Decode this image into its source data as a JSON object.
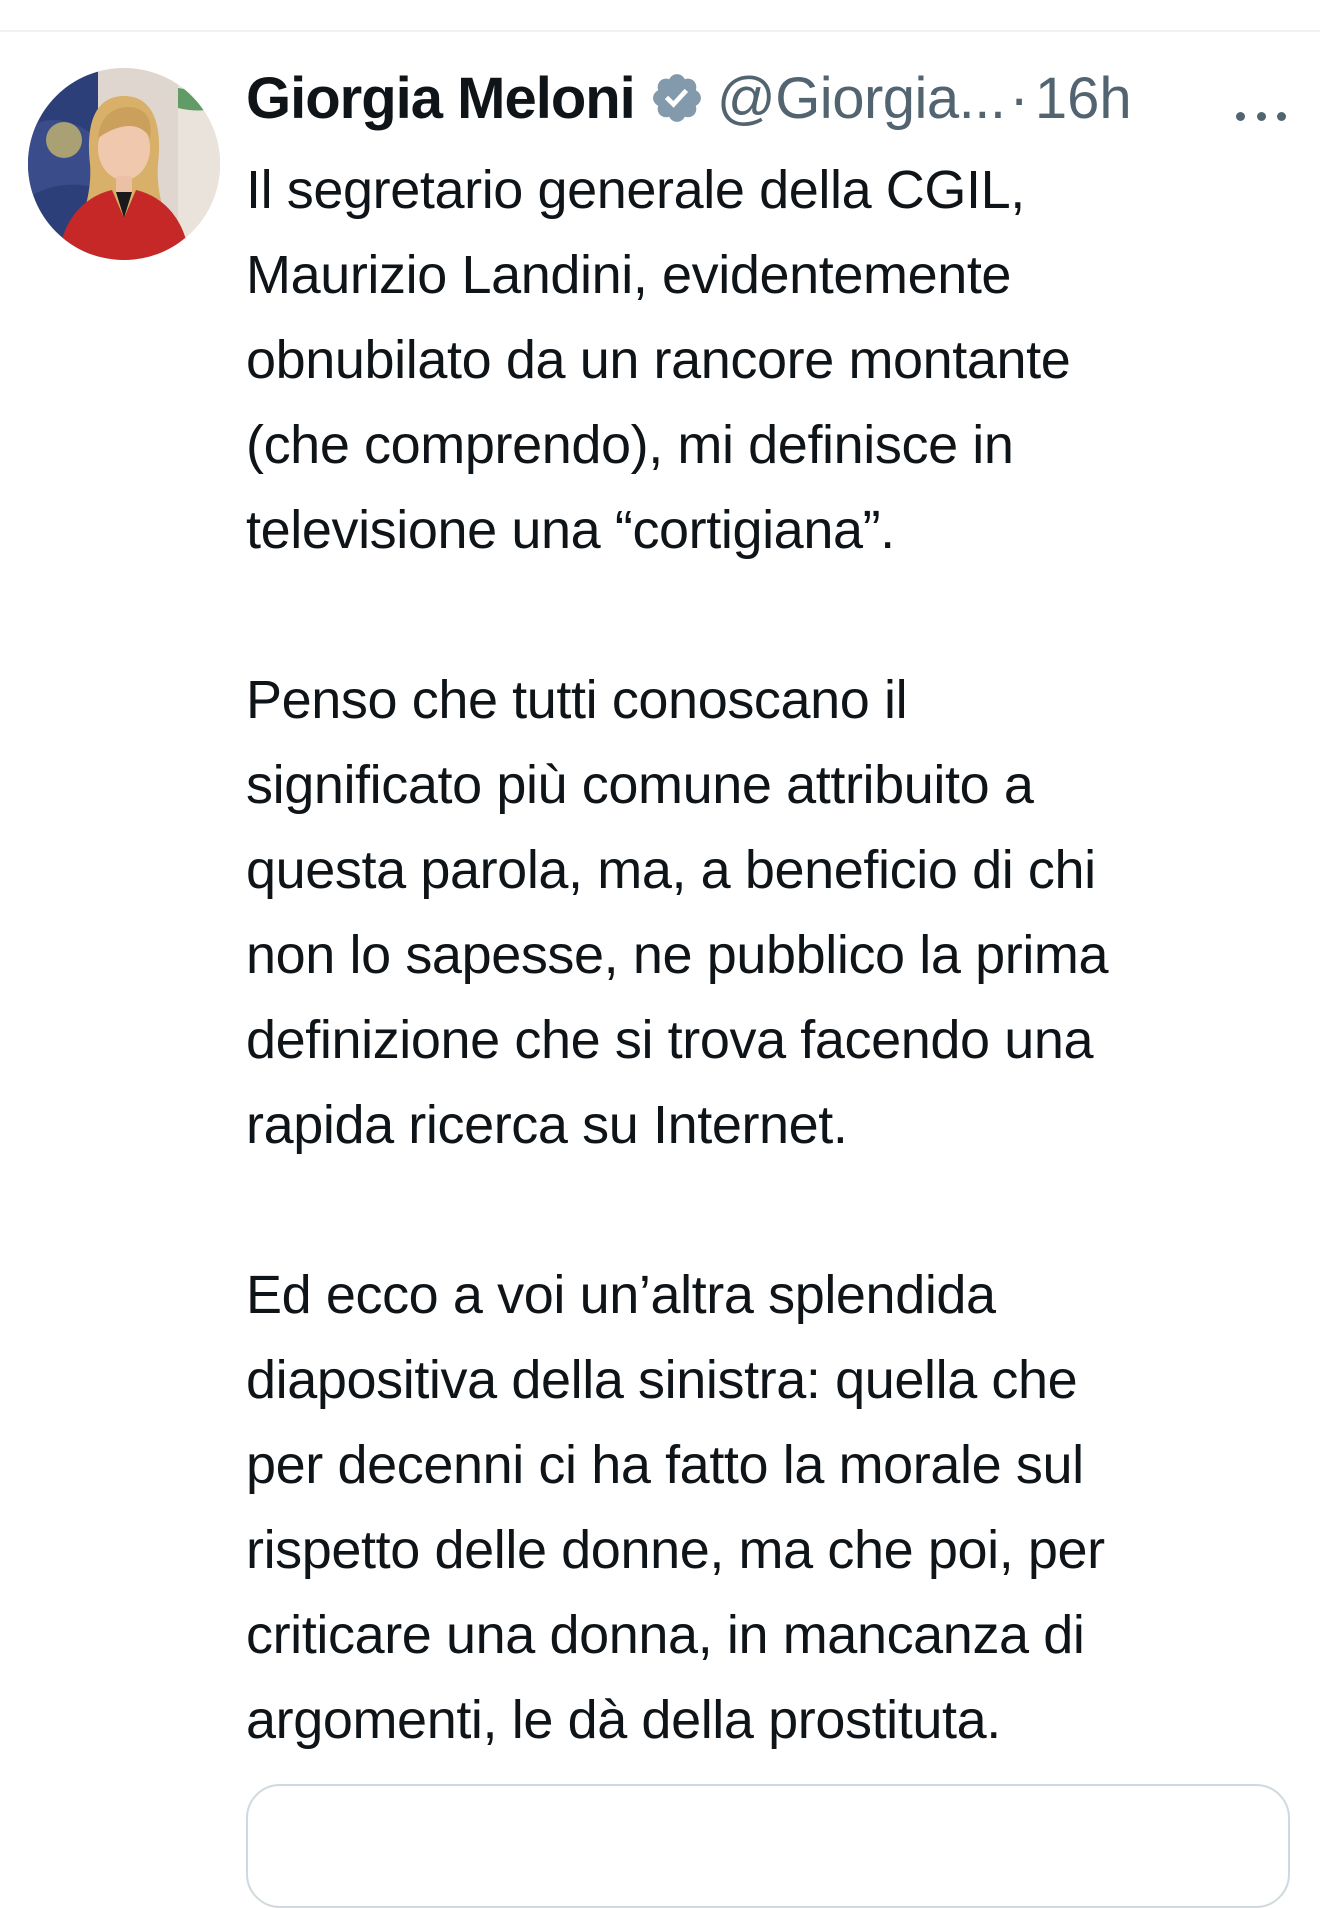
{
  "tweet": {
    "author": {
      "display_name": "Giorgia Meloni",
      "verified_icon": "verified-badge-icon",
      "handle": "@Giorgia...",
      "separator": "·",
      "time": "16h"
    },
    "more_icon": "more-options-icon",
    "paragraphs": [
      {
        "lines": [
          "Il segretario generale della CGIL,",
          "Maurizio Landini, evidentemente",
          "obnubilato da un rancore montante",
          "(che comprendo), mi definisce in",
          "televisione una “cortigiana”."
        ]
      },
      {
        "lines": [
          "Penso che tutti conoscano il",
          "significato più comune attribuito a",
          "questa parola, ma, a beneficio di chi",
          "non lo sapesse, ne pubblico la prima",
          "definizione che si trova facendo una",
          "rapida ricerca su Internet."
        ]
      },
      {
        "lines": [
          "Ed ecco a voi un’altra splendida",
          "diapositiva della sinistra: quella che",
          "per decenni ci ha fatto la morale sul",
          "rispetto delle donne, ma che poi, per",
          "criticare una donna, in mancanza di",
          "argomenti, le dà della prostituta."
        ]
      }
    ]
  },
  "colors": {
    "text_primary": "#0f1419",
    "text_secondary": "#536471",
    "verified_badge": "#829aab",
    "divider": "#eff3f4",
    "card_border": "#cfd9de"
  }
}
